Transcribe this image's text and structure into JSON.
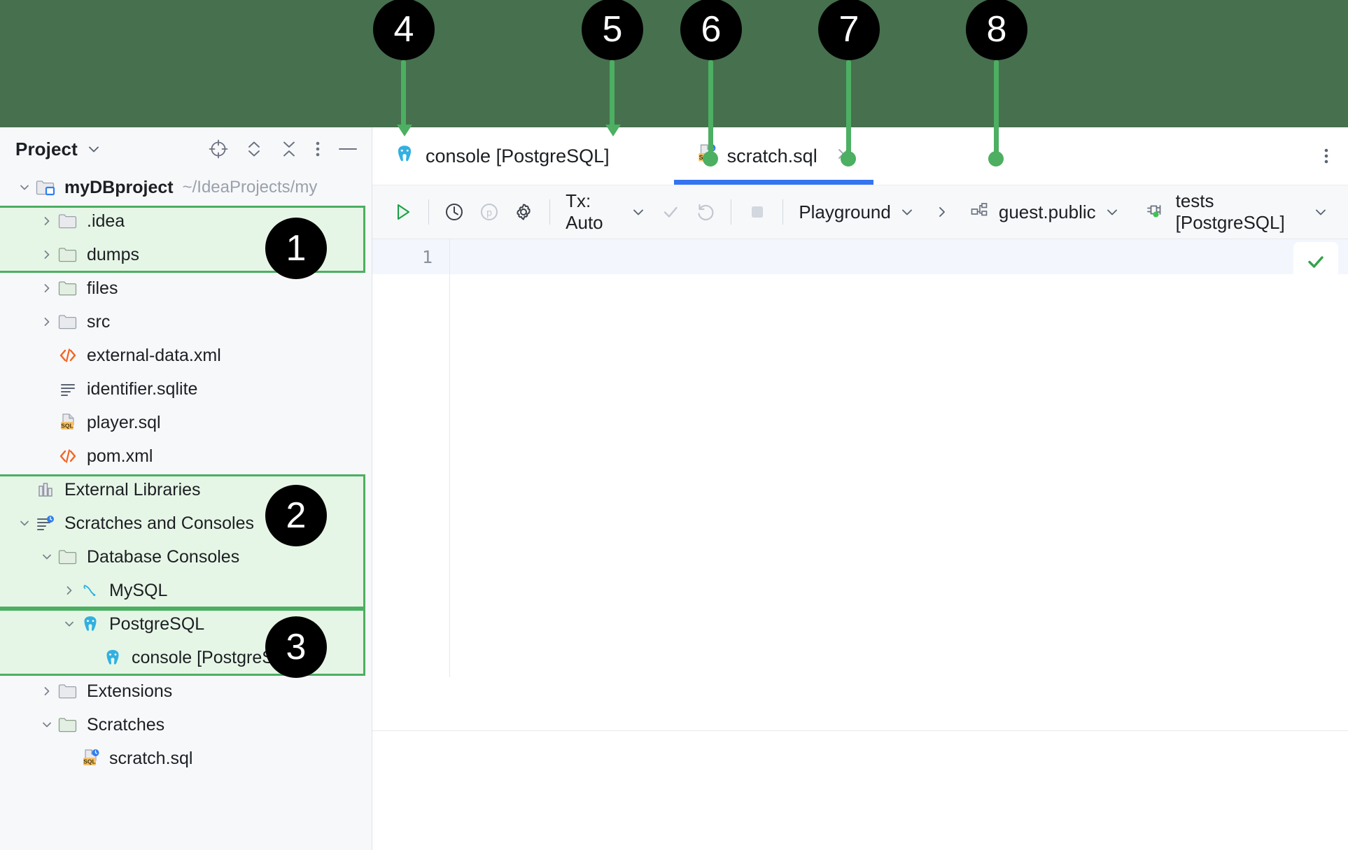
{
  "annotations": {
    "callouts": [
      {
        "num": "1",
        "target": "sidebar-dumps-files-group"
      },
      {
        "num": "2",
        "target": "sidebar-database-consoles-group"
      },
      {
        "num": "3",
        "target": "sidebar-scratches-group"
      },
      {
        "num": "4",
        "target": "tab-console-postgresql"
      },
      {
        "num": "5",
        "target": "tab-scratch-sql"
      },
      {
        "num": "6",
        "target": "toolbar-playground-session"
      },
      {
        "num": "7",
        "target": "toolbar-guest-public-schema"
      },
      {
        "num": "8",
        "target": "toolbar-tests-postgresql-datasource"
      }
    ],
    "highlight_color": "#4caf62",
    "highlight_fill": "#e6f6e6",
    "band_color": "#47704e"
  },
  "project_panel": {
    "title": "Project",
    "title_chevron_icon": "chevron-down-icon",
    "actions": [
      {
        "name": "select-opened-file-icon",
        "label": "Select Opened File"
      },
      {
        "name": "expand-all-icon",
        "label": "Expand All"
      },
      {
        "name": "collapse-all-icon",
        "label": "Collapse All"
      },
      {
        "name": "options-menu-icon",
        "label": "Options"
      },
      {
        "name": "hide-icon",
        "label": "Hide"
      }
    ],
    "tree": [
      {
        "label": "myDBproject",
        "sublabel": "~/IdeaProjects/my",
        "icon": "project-folder-icon",
        "indent": 0,
        "arrow": "down",
        "bold": true
      },
      {
        "label": ".idea",
        "sublabel": "",
        "icon": "folder-icon",
        "indent": 1,
        "arrow": "right",
        "bold": false
      },
      {
        "label": "dumps",
        "sublabel": "",
        "icon": "folder-icon",
        "indent": 1,
        "arrow": "right",
        "bold": false
      },
      {
        "label": "files",
        "sublabel": "",
        "icon": "folder-icon",
        "indent": 1,
        "arrow": "right",
        "bold": false
      },
      {
        "label": "src",
        "sublabel": "",
        "icon": "folder-icon",
        "indent": 1,
        "arrow": "right",
        "bold": false
      },
      {
        "label": "external-data.xml",
        "sublabel": "",
        "icon": "xml-file-icon",
        "indent": 1,
        "arrow": "none",
        "bold": false
      },
      {
        "label": "identifier.sqlite",
        "sublabel": "",
        "icon": "sqlite-file-icon",
        "indent": 1,
        "arrow": "none",
        "bold": false
      },
      {
        "label": "player.sql",
        "sublabel": "",
        "icon": "sql-file-icon",
        "indent": 1,
        "arrow": "none",
        "bold": false
      },
      {
        "label": "pom.xml",
        "sublabel": "",
        "icon": "xml-file-icon",
        "indent": 1,
        "arrow": "none",
        "bold": false
      },
      {
        "label": "External Libraries",
        "sublabel": "",
        "icon": "external-libraries-icon",
        "indent": 0,
        "arrow": "none",
        "bold": false
      },
      {
        "label": "Scratches and Consoles",
        "sublabel": "",
        "icon": "scratches-root-icon",
        "indent": 0,
        "arrow": "down",
        "bold": false
      },
      {
        "label": "Database Consoles",
        "sublabel": "",
        "icon": "folder-icon",
        "indent": 1,
        "arrow": "down",
        "bold": false
      },
      {
        "label": "MySQL",
        "sublabel": "",
        "icon": "mysql-icon",
        "indent": 2,
        "arrow": "right",
        "bold": false
      },
      {
        "label": "PostgreSQL",
        "sublabel": "",
        "icon": "postgresql-icon",
        "indent": 2,
        "arrow": "down",
        "bold": false
      },
      {
        "label": "console [PostgreSQL]",
        "sublabel": "",
        "icon": "postgresql-icon",
        "indent": 3,
        "arrow": "none",
        "bold": false
      },
      {
        "label": "Extensions",
        "sublabel": "",
        "icon": "folder-icon",
        "indent": 1,
        "arrow": "right",
        "bold": false
      },
      {
        "label": "Scratches",
        "sublabel": "",
        "icon": "folder-icon",
        "indent": 1,
        "arrow": "down",
        "bold": false
      },
      {
        "label": "scratch.sql",
        "sublabel": "",
        "icon": "sql-scratch-file-icon",
        "indent": 2,
        "arrow": "none",
        "bold": false,
        "selected": true
      }
    ]
  },
  "editor": {
    "tabs": [
      {
        "label": "console [PostgreSQL]",
        "icon": "postgresql-icon",
        "active": false,
        "closable": false
      },
      {
        "label": "scratch.sql",
        "icon": "sql-scratch-file-icon",
        "active": true,
        "closable": true,
        "close_icon": "close-icon"
      }
    ],
    "tabbar_more_icon": "more-vertical-icon",
    "toolbar": {
      "run_label": "Execute",
      "run_icon": "run-triangle-icon",
      "history_icon": "history-clock-icon",
      "parameters_icon": "parameters-p-icon",
      "settings_icon": "gear-icon",
      "tx_label": "Tx: Auto",
      "tx_chevron_icon": "chevron-down-icon",
      "commit_icon": "commit-check-icon",
      "rollback_icon": "rollback-arrow-icon",
      "stop_icon": "stop-square-icon",
      "session_label": "Playground",
      "session_chevron_icon": "chevron-down-icon",
      "breadcrumb_separator_icon": "chevron-right-icon",
      "schema_label": "guest.public",
      "schema_icon": "schema-icon",
      "schema_chevron_icon": "chevron-down-icon",
      "datasource_label": "tests [PostgreSQL]",
      "datasource_icon": "datasource-plug-icon",
      "datasource_chevron_icon": "chevron-down-icon"
    },
    "code": {
      "line_numbers": [
        "1"
      ],
      "lines": [
        ""
      ],
      "inspection_icon": "inspection-ok-check-icon"
    }
  }
}
